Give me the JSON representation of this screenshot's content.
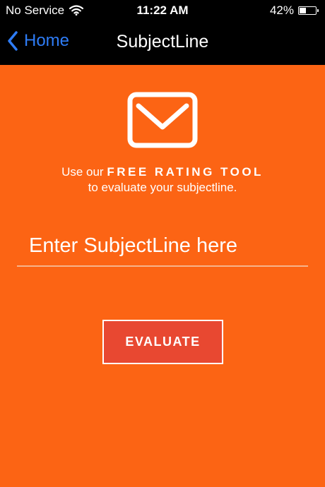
{
  "status_bar": {
    "carrier": "No Service",
    "time": "11:22 AM",
    "battery_percent_label": "42%",
    "battery_level": 0.42
  },
  "nav": {
    "back_label": "Home",
    "title": "SubjectLine",
    "accent_color": "#2e7cf6"
  },
  "main": {
    "background_color": "#fc6414",
    "tagline": {
      "prefix": "Use our",
      "emphasis": "FREE RATING TOOL",
      "suffix": "to evaluate your subjectline."
    },
    "subject_input": {
      "placeholder": "Enter SubjectLine here",
      "value": ""
    },
    "evaluate_button": {
      "label": "EVALUATE",
      "color": "#e84831"
    }
  },
  "icons": {
    "back": "chevron-left-icon",
    "wifi": "wifi-icon",
    "battery": "battery-icon",
    "mail": "envelope-icon"
  }
}
